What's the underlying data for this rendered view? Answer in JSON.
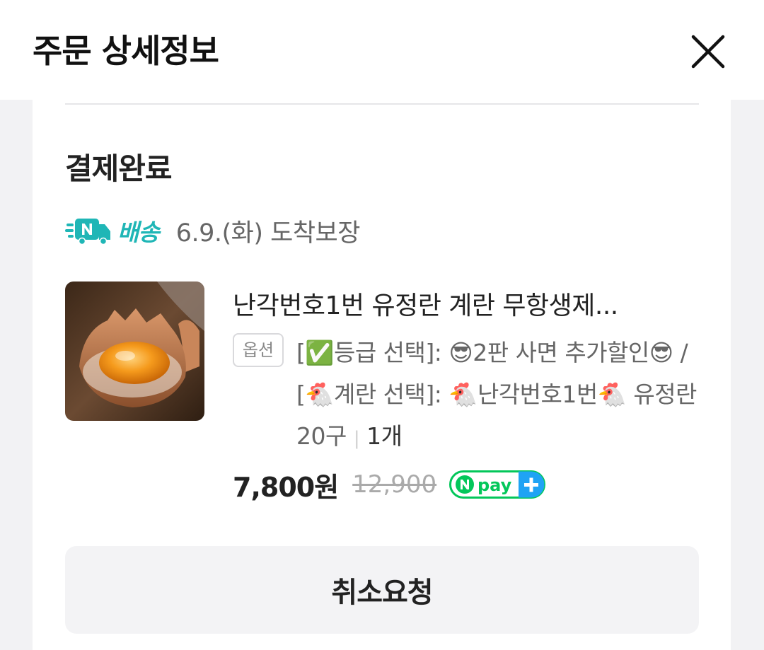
{
  "header": {
    "title": "주문 상세정보"
  },
  "order": {
    "status": "결제완료",
    "delivery": {
      "badge_label": "배송",
      "arrival_text": "6.9.(화) 도착보장"
    },
    "product": {
      "name": "난각번호1번 유정란 계란 무항생제...",
      "option_badge": "옵션",
      "option_text": "[✅등급 선택]: 😎2판 사면 추가할인😎 / [🐔계란 선택]: 🐔난각번호1번🐔 유정란 20구",
      "quantity": "1개",
      "price": "7,800원",
      "original_price": "12,900"
    },
    "cancel_button": "취소요청"
  },
  "colors": {
    "accent_teal": "#1fb6b6",
    "npay_green": "#03c75a",
    "npay_blue": "#1fa3f4"
  },
  "icons": {
    "close": "close-icon",
    "delivery": "truck-icon",
    "payment": "npay-plus-icon"
  }
}
